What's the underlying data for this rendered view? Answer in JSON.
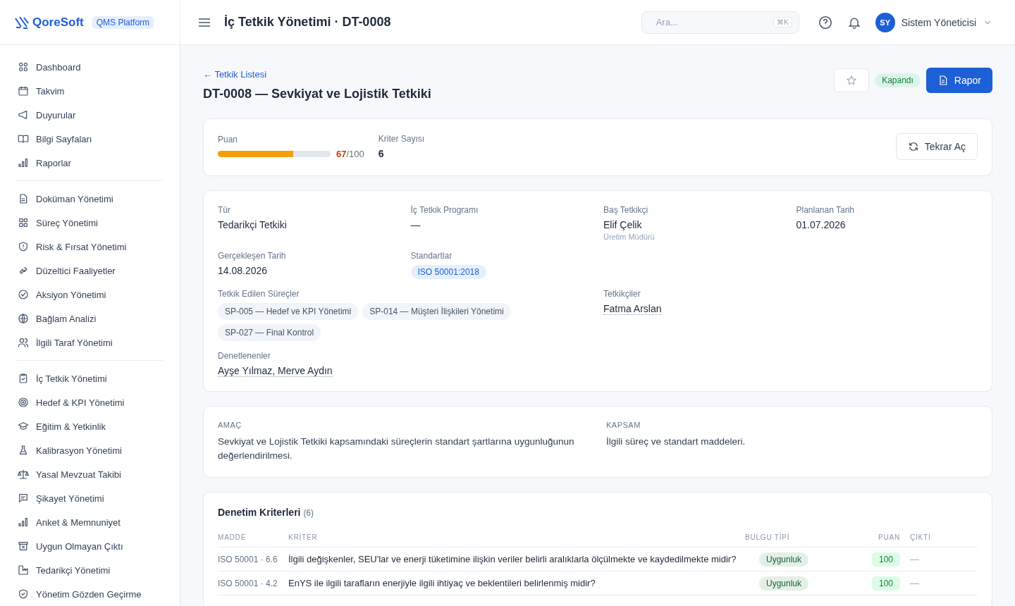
{
  "brand": {
    "name": "QoreSoft",
    "badge": "QMS Platform"
  },
  "sidebar": {
    "groups": [
      [
        {
          "label": "Dashboard",
          "selected": false
        },
        {
          "label": "Takvim",
          "selected": false
        },
        {
          "label": "Duyurular",
          "selected": false
        },
        {
          "label": "Bilgi Sayfaları",
          "selected": false
        },
        {
          "label": "Raporlar",
          "selected": false
        }
      ],
      [
        {
          "label": "Doküman Yönetimi",
          "selected": false
        },
        {
          "label": "Süreç Yönetimi",
          "selected": false
        },
        {
          "label": "Risk & Fırsat Yönetimi",
          "selected": false
        },
        {
          "label": "Düzeltici Faaliyetler",
          "selected": false
        },
        {
          "label": "Aksiyon Yönetimi",
          "selected": false
        },
        {
          "label": "Bağlam Analizi",
          "selected": false
        },
        {
          "label": "İlgili Taraf Yönetimi",
          "selected": false
        }
      ],
      [
        {
          "label": "İç Tetkik Yönetimi",
          "selected": false
        },
        {
          "label": "Hedef & KPI Yönetimi",
          "selected": false
        },
        {
          "label": "Eğitim & Yetkinlik",
          "selected": false
        },
        {
          "label": "Kalibrasyon Yönetimi",
          "selected": false
        },
        {
          "label": "Yasal Mevzuat Takibi",
          "selected": false
        },
        {
          "label": "Şikayet Yönetimi",
          "selected": false
        },
        {
          "label": "Anket & Memnuniyet",
          "selected": false
        },
        {
          "label": "Uygun Olmayan Çıktı",
          "selected": false
        },
        {
          "label": "Tedarikçi Yönetimi",
          "selected": false
        },
        {
          "label": "Yönetim Gözden Geçirme",
          "selected": false
        }
      ]
    ]
  },
  "header": {
    "title": "İç Tetkik Yönetimi · DT-0008",
    "search": {
      "placeholder": "Ara...",
      "shortcut": "⌘K"
    },
    "user": {
      "initials": "SY",
      "name": "Sistem Yöneticisi"
    }
  },
  "page": {
    "back_link": "← Tetkik Listesi",
    "title": "DT-0008 — Sevkiyat ve Lojistik Tetkiki",
    "favorite": false,
    "status": "Kapandı",
    "report_button": "Rapor"
  },
  "summary": {
    "score_label": "Puan",
    "level": 0.67,
    "score": "67",
    "score_max": "/100",
    "criteria_label": "Kriter Sayısı",
    "criteria_count": "6",
    "reopen_button": "Tekrar Aç"
  },
  "details": {
    "rows": [
      [
        {
          "kind": "text",
          "label": "Tür",
          "value": "Tedarikçi Tetkiki"
        },
        {
          "kind": "text",
          "label": "İç Tetkik Programı",
          "value": "—"
        },
        {
          "kind": "text",
          "label": "Baş Tetkikçi",
          "value": "Elif Çelik",
          "note": "Üretim Müdürü"
        },
        {
          "kind": "text",
          "label": "Planlanan Tarih",
          "value": "01.07.2026"
        }
      ],
      [
        {
          "kind": "text",
          "label": "Gerçekleşen Tarih",
          "value": "14.08.2026"
        },
        {
          "kind": "standards",
          "label": "Standartlar",
          "tags": [
            "ISO 50001:2018"
          ]
        }
      ],
      [
        {
          "kind": "processes",
          "label": "Tetkik Edilen Süreçler",
          "tags": [
            "SP-005 — Hedef ve KPI Yönetimi",
            "SP-014 — Müşteri İlişkileri Yönetimi",
            "SP-027 — Final Kontrol"
          ]
        },
        "",
        {
          "kind": "people",
          "label": "Tetkikçiler",
          "value": "Fatma Arslan"
        }
      ],
      [
        {
          "kind": "people",
          "label": "Denetlenenler",
          "value": "Ayşe Yılmaz, Merve Aydın"
        }
      ]
    ]
  },
  "scope": [
    {
      "label": "AMAÇ",
      "text": "Sevkiyat ve Lojistik Tetkiki kapsamındaki süreçlerin standart şartlarına uygunluğunun değerlendirilmesi."
    },
    {
      "label": "KAPSAM",
      "text": "İlgili süreç ve standart maddeleri."
    }
  ],
  "criteria": {
    "title": "Denetim Kriterleri",
    "count": "(6)",
    "columns": [
      "MADDE",
      "KRİTER",
      "BULGU TİPİ",
      "PUAN",
      "ÇIKTI"
    ],
    "rows": [
      {
        "clause": "ISO 50001 · 6.6",
        "criterion": "İlgili değişkenler, SEU'lar ve enerji tüketimine ilişkin veriler belirli aralıklarla ölçülmekte ve kaydedilmekte midir?",
        "finding": "Uygunluk",
        "score": "100",
        "output": "—"
      },
      {
        "clause": "ISO 50001 · 4.2",
        "criterion": "EnYS ile ilgili tarafların enerjiyle ilgili ihtiyaç ve beklentileri belirlenmiş midir?",
        "finding": "Uygunluk",
        "score": "100",
        "output": "—"
      }
    ]
  }
}
